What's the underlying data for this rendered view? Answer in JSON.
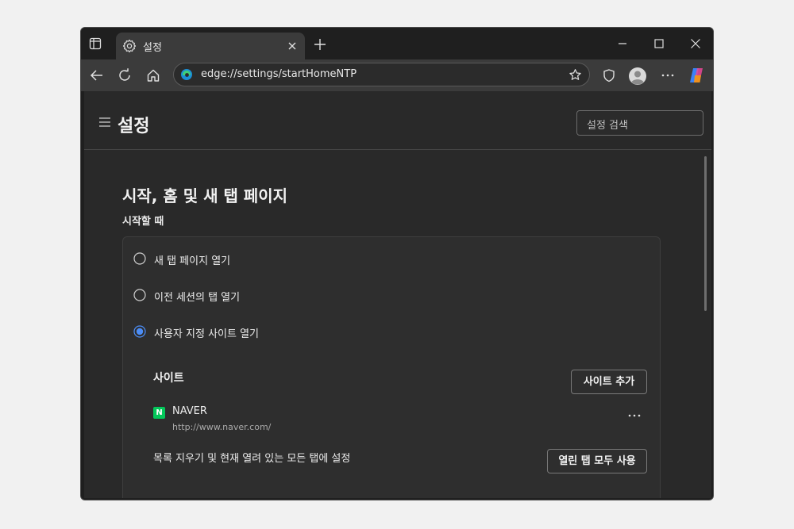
{
  "tab": {
    "title": "설정"
  },
  "omnibox": {
    "url": "edge://settings/startHomeNTP"
  },
  "header": {
    "title": "설정",
    "search_placeholder": "설정 검색"
  },
  "section": {
    "title": "시작, 홈 및 새 탭 페이지",
    "subtitle": "시작할 때",
    "options": [
      {
        "label": "새 탭 페이지 열기",
        "selected": false
      },
      {
        "label": "이전 세션의 탭 열기",
        "selected": false
      },
      {
        "label": "사용자 지정 사이트 열기",
        "selected": true
      }
    ],
    "sites_label": "사이트",
    "add_site_label": "사이트 추가",
    "sites": [
      {
        "name": "NAVER",
        "url": "http://www.naver.com/",
        "icon_letter": "N"
      }
    ],
    "clear_text": "목록 지우기 및 현재 열려 있는 모든 탭에 설정",
    "use_all_tabs_label": "열린 탭 모두 사용"
  },
  "colors": {
    "accent": "#4c8df6",
    "window_bg": "#1f1f1f",
    "content_bg": "#292929",
    "naver_green": "#03c75a"
  }
}
